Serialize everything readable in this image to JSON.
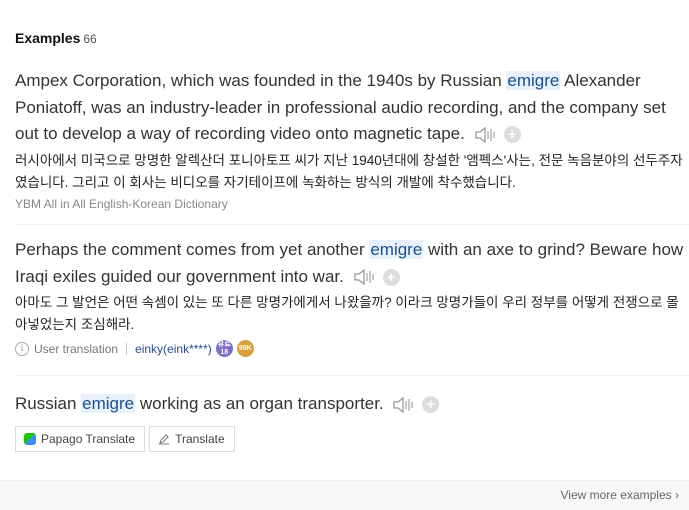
{
  "header": {
    "title": "Examples",
    "count": "66"
  },
  "examples": [
    {
      "en_pre": "Ampex Corporation, which was founded in the 1940s by Russian ",
      "keyword": "emigre",
      "en_post": " Alexander Poniatoff, was an industry-leader in professional audio recording, and the company set out to develop a way of recording video onto magnetic tape.",
      "ko": "러시아에서 미국으로 망명한 알렉산더 포니아토프 씨가 지난 1940년대에 창설한 '앰펙스'사는, 전문 녹음분야의 선두주자였습니다. 그리고 이 회사는 비디오를 자기테이프에 녹화하는 방식의 개발에 착수했습니다.",
      "source": "YBM All in All English-Korean Dictionary"
    },
    {
      "en_pre": "Perhaps the comment comes from yet another ",
      "keyword": "emigre",
      "en_post": " with an axe to grind? Beware how Iraqi exiles guided our government into war.",
      "ko": "아마도 그 발언은 어떤 속셈이 있는 또 다른 망명가에게서 나왔을까? 이라크 망명가들이 우리 정부를 어떻게 전쟁으로 몰아넣었는지 조심해라.",
      "user_translation_label": "User translation",
      "user": "einky(eink****)",
      "badge1": "유료 18",
      "badge2": "99K"
    },
    {
      "en_pre": "Russian ",
      "keyword": "emigre",
      "en_post": " working as an organ transporter.",
      "papago_label": "Papago Translate",
      "translate_label": "Translate"
    }
  ],
  "footer": {
    "more_label": "View more examples"
  }
}
